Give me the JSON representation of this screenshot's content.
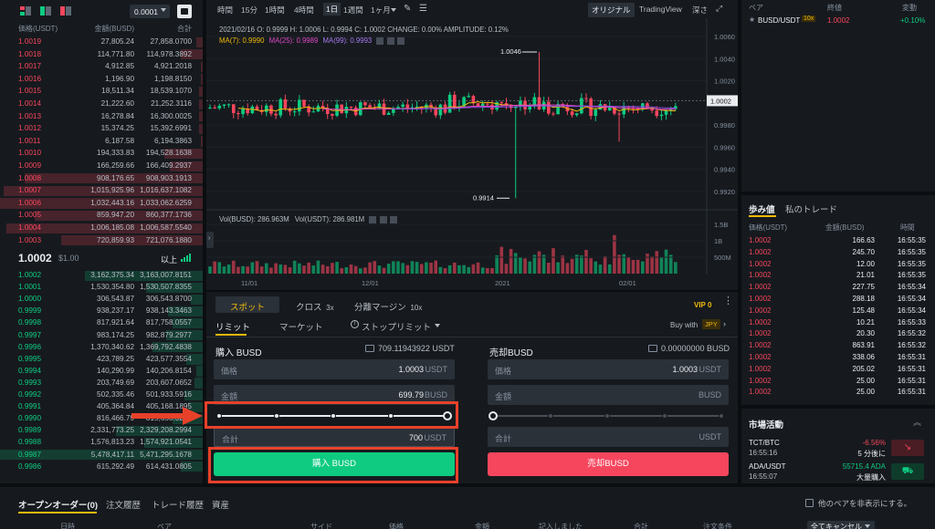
{
  "orderbook": {
    "precision": "0.0001",
    "columns": [
      "価格(USDT)",
      "金額(BUSD)",
      "合計"
    ],
    "asks": [
      [
        "1.0019",
        "27,805.24",
        "27,858.0700"
      ],
      [
        "1.0018",
        "114,771.80",
        "114,978.3892"
      ],
      [
        "1.0017",
        "4,912.85",
        "4,921.2018"
      ],
      [
        "1.0016",
        "1,196.90",
        "1,198.8150"
      ],
      [
        "1.0015",
        "18,511.34",
        "18,539.1070"
      ],
      [
        "1.0014",
        "21,222.60",
        "21,252.3116"
      ],
      [
        "1.0013",
        "16,278.84",
        "16,300.0025"
      ],
      [
        "1.0012",
        "15,374.25",
        "15,392.6991"
      ],
      [
        "1.0011",
        "6,187.58",
        "6,194.3863"
      ],
      [
        "1.0010",
        "194,333.83",
        "194,528.1638"
      ],
      [
        "1.0009",
        "166,259.66",
        "166,409.2937"
      ],
      [
        "1.0008",
        "908,176.65",
        "908,903.1913"
      ],
      [
        "1.0007",
        "1,015,925.96",
        "1,016,637.1082"
      ],
      [
        "1.0006",
        "1,032,443.16",
        "1,033,062.6259"
      ],
      [
        "1.0005",
        "859,947.20",
        "860,377.1736"
      ],
      [
        "1.0004",
        "1,006,185.08",
        "1,006,587.5540"
      ],
      [
        "1.0003",
        "720,859.93",
        "721,076.1880"
      ]
    ],
    "ask_depth": [
      0.03,
      0.11,
      0.01,
      0.01,
      0.02,
      0.02,
      0.02,
      0.02,
      0.01,
      0.19,
      0.16,
      0.88,
      0.98,
      1.0,
      0.83,
      0.97,
      0.7
    ],
    "last_price": "1.0002",
    "last_usd": "$1.00",
    "more_label": "以上",
    "bids": [
      [
        "1.0002",
        "3,162,375.34",
        "3,163,007.8151"
      ],
      [
        "1.0001",
        "1,530,354.80",
        "1,530,507.8355"
      ],
      [
        "1.0000",
        "306,543.87",
        "306,543.8700"
      ],
      [
        "0.9999",
        "938,237.17",
        "938,143.3463"
      ],
      [
        "0.9998",
        "817,921.64",
        "817,758.0557"
      ],
      [
        "0.9997",
        "983,174.25",
        "982,879.2977"
      ],
      [
        "0.9996",
        "1,370,340.62",
        "1,369,792.4838"
      ],
      [
        "0.9995",
        "423,789.25",
        "423,577.3554"
      ],
      [
        "0.9994",
        "140,290.99",
        "140,206.8154"
      ],
      [
        "0.9993",
        "203,749.69",
        "203,607.0652"
      ],
      [
        "0.9992",
        "502,335.46",
        "501,933.5916"
      ],
      [
        "0.9991",
        "405,364.84",
        "405,168.1895"
      ],
      [
        "0.9990",
        "816,466.79",
        "815,650.3232"
      ],
      [
        "0.9989",
        "2,331,773.25",
        "2,329,208.2994"
      ],
      [
        "0.9988",
        "1,576,813.23",
        "1,574,921.0541"
      ],
      [
        "0.9987",
        "5,478,417.11",
        "5,471,295.1678"
      ],
      [
        "0.9986",
        "615,292.49",
        "614,431.0805"
      ]
    ],
    "bid_depth": [
      0.58,
      0.28,
      0.06,
      0.17,
      0.15,
      0.18,
      0.25,
      0.08,
      0.03,
      0.04,
      0.09,
      0.07,
      0.15,
      0.43,
      0.29,
      1.0,
      0.11
    ]
  },
  "chart": {
    "toolbar": [
      "時間",
      "15分",
      "1時間",
      "4時間",
      "1日",
      "1週間",
      "1ヶ月"
    ],
    "active_interval": "1日",
    "view_original": "オリジナル",
    "view_tradingview": "TradingView",
    "view_depth": "深さ",
    "ohlc_line": "2021/02/16  O: 0.9999  H: 1.0006  L: 0.9994  C: 1.0002  CHANGE: 0.00%  AMPLITUDE: 0.12%",
    "ma_line": {
      "ma7": "MA(7): 0.9990",
      "ma25": "MA(25): 0.9989",
      "ma99": "MA(99): 0.9993"
    },
    "vol_line": {
      "busd": "Vol(BUSD): 286.963M",
      "usdt": "Vol(USDT): 286.981M"
    },
    "price_ticks": [
      "1.0060",
      "1.0040",
      "1.0020",
      "0.9980",
      "0.9960",
      "0.9940",
      "0.9920"
    ],
    "current_price": "1.0002",
    "high_marker": "1.0046",
    "low_marker": "0.9914",
    "vol_ticks": [
      "1.5B",
      "1B",
      "500M"
    ],
    "date_ticks": [
      "11/01",
      "12/01",
      "2021",
      "02/01"
    ],
    "colors": {
      "up": "#0ecb81",
      "down": "#f6465d",
      "ma7": "#f0b90b",
      "ma25": "#e148c8",
      "ma99": "#8a4ddf"
    }
  },
  "trade": {
    "tabs": {
      "spot": "スポット",
      "cross": "クロス",
      "cross_mult": "3x",
      "isolated": "分離マージン",
      "isolated_mult": "10x"
    },
    "vip": "VIP 0",
    "order_types": {
      "limit": "リミット",
      "market": "マーケット",
      "stop_limit": "ストップリミット"
    },
    "buy_with": "Buy with",
    "buy_with_currency": "JPY",
    "buy": {
      "title": "購入 BUSD",
      "balance": "709.11943922 USDT",
      "price_label": "価格",
      "price_value": "1.0003",
      "price_unit": "USDT",
      "amount_label": "金額",
      "amount_value": "699.79",
      "amount_unit": "BUSD",
      "total_label": "合計",
      "total_value": "700",
      "total_unit": "USDT",
      "slider": 1.0,
      "button": "購入 BUSD"
    },
    "sell": {
      "title": "売却BUSD",
      "balance": "0.00000000 BUSD",
      "price_label": "価格",
      "price_value": "1.0003",
      "price_unit": "USDT",
      "amount_label": "金額",
      "amount_unit": "BUSD",
      "total_label": "合計",
      "total_unit": "USDT",
      "slider": 0.0,
      "button": "売却BUSD"
    }
  },
  "pairs": {
    "columns": [
      "ペア",
      "終値",
      "変動"
    ],
    "row": {
      "pair": "BUSD/USDT",
      "leverage": "10x",
      "price": "1.0002",
      "change": "+0.10%"
    }
  },
  "trades": {
    "tabs": [
      "歩み値",
      "私のトレード"
    ],
    "columns": [
      "価格(USDT)",
      "金額(BUSD)",
      "時間"
    ],
    "rows": [
      [
        "1.0002",
        "166.63",
        "16:55:35"
      ],
      [
        "1.0002",
        "245.70",
        "16:55:35"
      ],
      [
        "1.0002",
        "12.00",
        "16:55:35"
      ],
      [
        "1.0002",
        "21.01",
        "16:55:35"
      ],
      [
        "1.0002",
        "227.75",
        "16:55:34"
      ],
      [
        "1.0002",
        "288.18",
        "16:55:34"
      ],
      [
        "1.0002",
        "125.48",
        "16:55:34"
      ],
      [
        "1.0002",
        "10.21",
        "16:55:33"
      ],
      [
        "1.0002",
        "20.30",
        "16:55:32"
      ],
      [
        "1.0002",
        "863.91",
        "16:55:32"
      ],
      [
        "1.0002",
        "338.06",
        "16:55:31"
      ],
      [
        "1.0002",
        "205.02",
        "16:55:31"
      ],
      [
        "1.0002",
        "25.00",
        "16:55:31"
      ],
      [
        "1.0002",
        "25.00",
        "16:55:31"
      ]
    ]
  },
  "market": {
    "title": "市場活動",
    "items": [
      {
        "pair": "TCT/BTC",
        "time": "16:55:16",
        "value": "-6.56%",
        "desc": "5 分後に"
      },
      {
        "pair": "ADA/USDT",
        "time": "16:55:07",
        "value": "55715.4 ADA",
        "desc": "大量購入"
      }
    ]
  },
  "bottom": {
    "tabs": [
      "オープンオーダー(0)",
      "注文履歴",
      "トレード履歴",
      "資産"
    ],
    "hide_pairs": "他のペアを非表示にする。",
    "columns": [
      "日時",
      "ペア",
      "サイド",
      "価格",
      "金額",
      "記入しました",
      "合計",
      "注文条件"
    ],
    "cancel_all": "全てキャンセル"
  }
}
